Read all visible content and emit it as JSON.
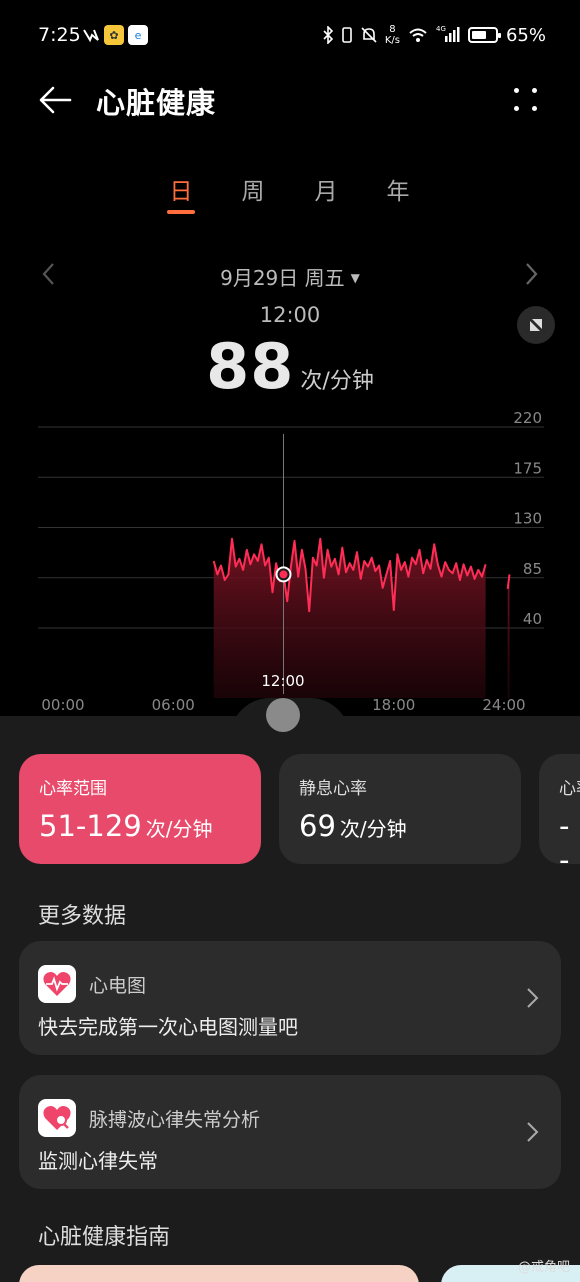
{
  "status_bar": {
    "time": "7:25",
    "net_speed_value": "8",
    "net_speed_unit": "K/s",
    "signal_label": "4G",
    "battery": "65%",
    "battery_level": 0.65
  },
  "header": {
    "title": "心脏健康"
  },
  "tabs": [
    {
      "label": "日",
      "active": true
    },
    {
      "label": "周",
      "active": false
    },
    {
      "label": "月",
      "active": false
    },
    {
      "label": "年",
      "active": false
    }
  ],
  "date_nav": {
    "date": "9月29日 周五",
    "caret": "▼"
  },
  "selection": {
    "time": "12:00",
    "value": "88",
    "unit": "次/分钟"
  },
  "timeline": {
    "label": "12:00"
  },
  "colors": {
    "accent": "#ff6e3c",
    "range_card": "#e84a6b",
    "line": "#ff2d55"
  },
  "chart_data": {
    "type": "line",
    "x_unit": "hour",
    "xlim": [
      0,
      24
    ],
    "ylim": [
      0,
      220
    ],
    "yticks": [
      220,
      175,
      130,
      85,
      40
    ],
    "xticks": [
      "00:00",
      "06:00",
      "12:00",
      "18:00",
      "24:00"
    ],
    "grid": true,
    "selected": {
      "x": 12.0,
      "y": 88
    },
    "series": [
      {
        "x": [
          8.2,
          8.4,
          8.6,
          8.8,
          9.0,
          9.2,
          9.4,
          9.6,
          9.8,
          10.0,
          10.2,
          10.4,
          10.6,
          10.8,
          11.0,
          11.2,
          11.4,
          11.6,
          11.8,
          12.0,
          12.2,
          12.4,
          12.6,
          12.8,
          13.0,
          13.2,
          13.4,
          13.6,
          13.8,
          14.0,
          14.2,
          14.4,
          14.6,
          14.8,
          15.0,
          15.2,
          15.4,
          15.6,
          15.8,
          16.0,
          16.2,
          16.4,
          16.6,
          16.8,
          17.0,
          17.2,
          17.4,
          17.6,
          17.8,
          18.0,
          18.2,
          18.4,
          18.6,
          18.8,
          19.0,
          19.2,
          19.4,
          19.6,
          19.8,
          20.0,
          20.2,
          20.4,
          20.6,
          20.8,
          21.0,
          21.2,
          21.4,
          21.6,
          21.8,
          22.0,
          22.2,
          22.4,
          22.6,
          22.8,
          23.0
        ],
        "y": [
          100,
          88,
          96,
          83,
          88,
          120,
          95,
          102,
          92,
          110,
          97,
          106,
          100,
          115,
          96,
          103,
          72,
          98,
          82,
          88,
          64,
          95,
          118,
          86,
          110,
          93,
          55,
          103,
          96,
          120,
          85,
          110,
          95,
          102,
          88,
          112,
          90,
          98,
          92,
          108,
          84,
          100,
          95,
          103,
          91,
          96,
          76,
          88,
          100,
          56,
          106,
          92,
          99,
          86,
          103,
          97,
          110,
          89,
          101,
          93,
          115,
          97,
          86,
          99,
          92,
          89,
          98,
          83,
          97,
          87,
          95,
          84,
          92,
          86,
          97
        ]
      },
      {
        "x": [
          24.2,
          24.3
        ],
        "y": [
          75,
          88
        ]
      }
    ]
  },
  "stats": [
    {
      "label": "心率范围",
      "value": "51-129",
      "unit": "次/分钟"
    },
    {
      "label": "静息心率",
      "value": "69",
      "unit": "次/分钟"
    },
    {
      "label": "心率",
      "value": "--",
      "unit": ""
    }
  ],
  "more_data": {
    "section_title": "更多数据",
    "ecg": {
      "title": "心电图",
      "subtitle": "快去完成第一次心电图测量吧",
      "icon": "heart-ecg-icon"
    },
    "ppg": {
      "title": "脉搏波心律失常分析",
      "subtitle": "监测心律失常",
      "icon": "heart-search-icon"
    }
  },
  "guide": {
    "section_title": "心脏健康指南"
  },
  "watermark": "@戒角吧"
}
